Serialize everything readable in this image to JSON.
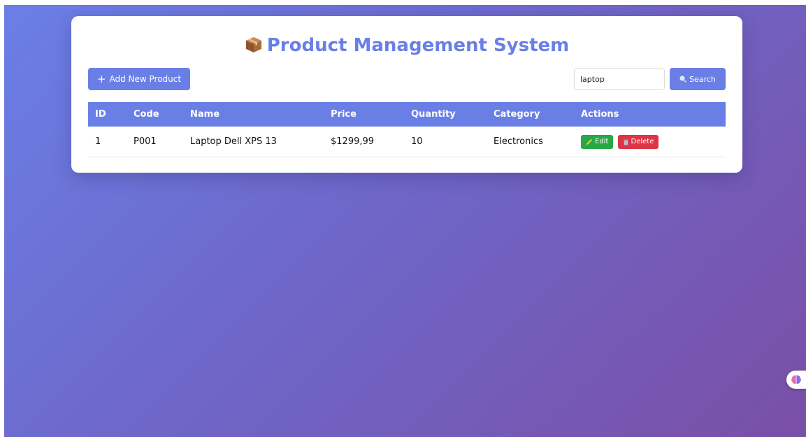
{
  "app": {
    "title": "Product Management System"
  },
  "toolbar": {
    "add_label": "Add New Product",
    "search_value": "laptop",
    "search_label": "Search"
  },
  "table": {
    "columns": [
      "ID",
      "Code",
      "Name",
      "Price",
      "Quantity",
      "Category",
      "Actions"
    ],
    "rows": [
      {
        "id": "1",
        "code": "P001",
        "name": "Laptop Dell XPS 13",
        "price": "$1299,99",
        "quantity": "10",
        "category": "Electronics",
        "edit_label": "Edit",
        "delete_label": "Delete"
      }
    ]
  },
  "colors": {
    "accent": "#6a7fe6",
    "edit": "#28a745",
    "delete": "#dc3545"
  },
  "icons": {
    "title": "package-icon",
    "add": "plus-icon",
    "search": "magnifier-icon",
    "edit": "pencil-icon",
    "delete": "trash-icon",
    "widget": "brain-icon"
  }
}
